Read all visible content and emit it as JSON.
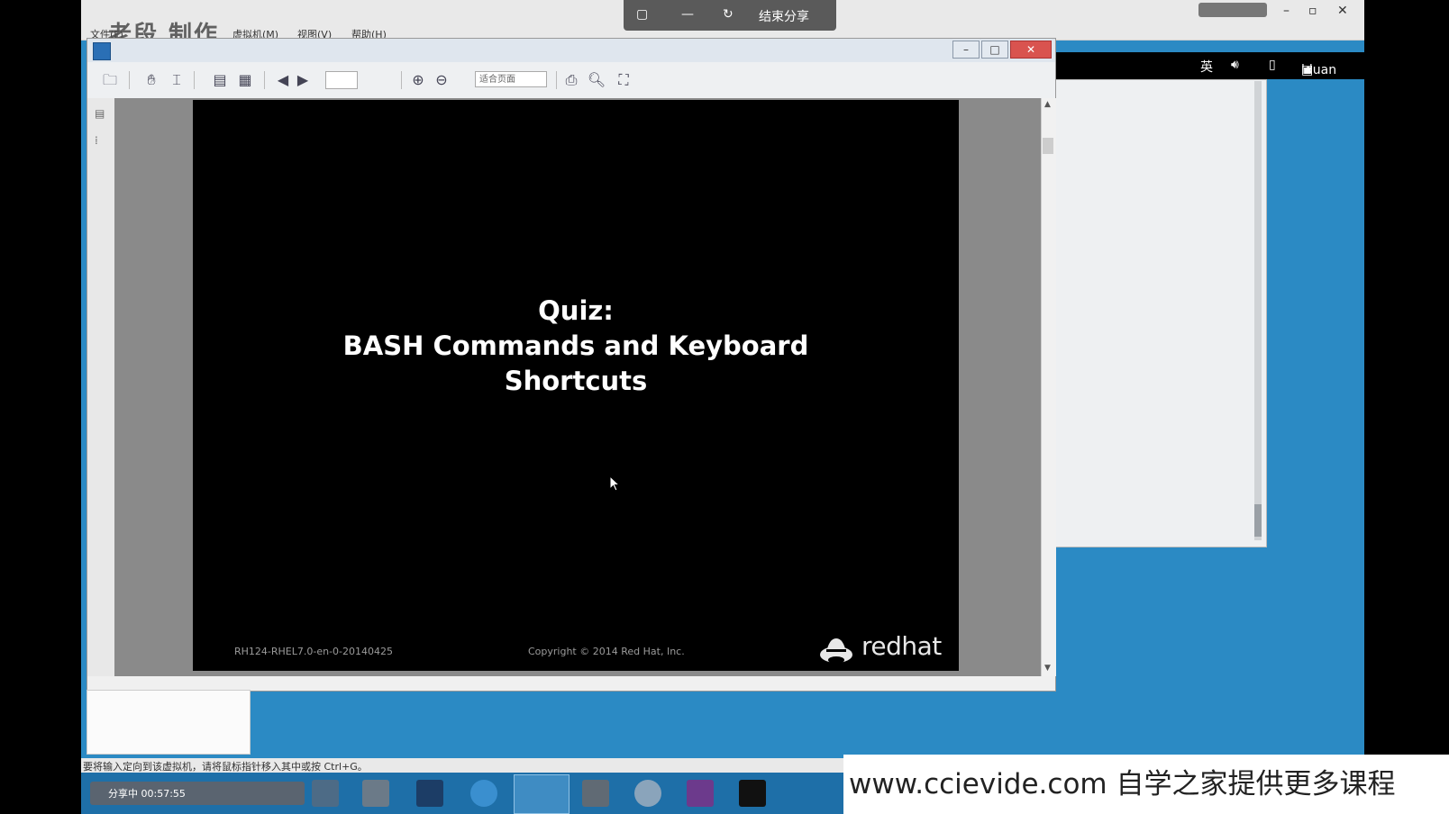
{
  "vm": {
    "watermark_text": "老段 制作",
    "menus": [
      "文件(F)",
      "虚拟机(M)",
      "视图(V)",
      "帮助(H)"
    ],
    "share_end_label": "结束分享",
    "topbar": {
      "ime": "英",
      "volume_icon": "volume-icon",
      "user": "lduan"
    }
  },
  "pdf": {
    "zoom_value": "适合页面",
    "slide": {
      "title_lines": [
        "Quiz:",
        "BASH Commands and Keyboard",
        "Shortcuts"
      ],
      "course_code": "RH124-RHEL7.0-en-0-20140425",
      "copyright": "Copyright © 2014 Red Hat, Inc.",
      "logo_text": "redhat"
    }
  },
  "status": {
    "text": "要将输入定向到该虚拟机，请将鼠标指针移入其中或按 Ctrl+G。"
  },
  "taskbar": {
    "share_label": "分享中 00:57:55",
    "icons": [
      "s-icon",
      "database-icon",
      "f-window-icon",
      "ct-icon",
      "viewer-icon",
      "media-icon",
      "bird-icon",
      "onenote-icon",
      "terminal-icon"
    ]
  },
  "site_watermark": "www.ccievide.com  自学之家提供更多课程",
  "colors": {
    "desktop_blue": "#2b8ac4",
    "taskbar": "#1e6fa8"
  }
}
